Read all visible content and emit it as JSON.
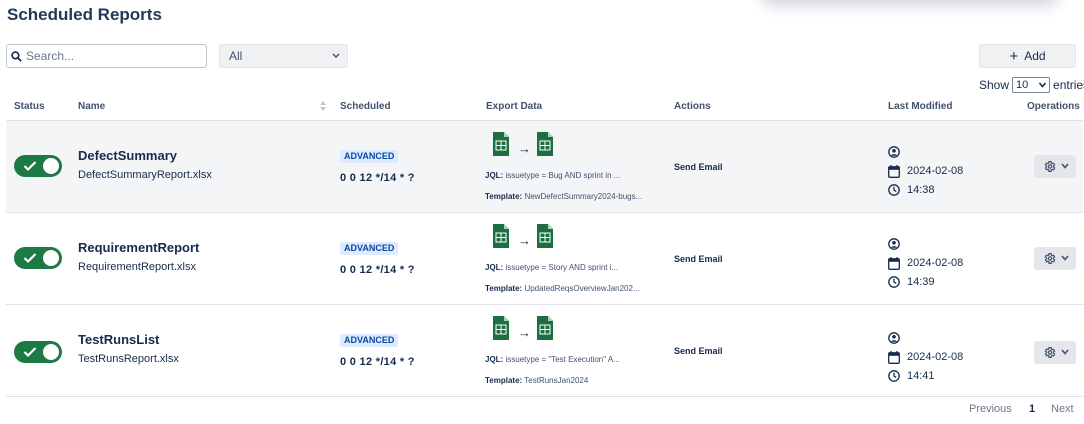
{
  "page": {
    "title": "Scheduled Reports"
  },
  "toolbar": {
    "search_placeholder": "Search...",
    "filter_value": "All",
    "add_label": "Add",
    "show_label": "Show",
    "entries_value": "10",
    "entries_label": "entries"
  },
  "columns": {
    "status": "Status",
    "name": "Name",
    "scheduled": "Scheduled",
    "export": "Export Data",
    "actions": "Actions",
    "modified": "Last Modified",
    "operations": "Operations"
  },
  "rows": [
    {
      "enabled": true,
      "name": "DefectSummary",
      "file": "DefectSummaryReport.xlsx",
      "badge": "ADVANCED",
      "cron": "0 0 12 */14 * ?",
      "jql_label": "JQL:",
      "jql": "issuetype = Bug AND sprint in ...",
      "template_label": "Template:",
      "template": "NewDefectSummary2024-bugs...",
      "action": "Send Email",
      "date": "2024-02-08",
      "time": "14:38"
    },
    {
      "enabled": true,
      "name": "RequirementReport",
      "file": "RequirementReport.xlsx",
      "badge": "ADVANCED",
      "cron": "0 0 12 */14 * ?",
      "jql_label": "JQL:",
      "jql": "issuetype = Story AND sprint i...",
      "template_label": "Template:",
      "template": "UpdatedReqsOverviewJan202...",
      "action": "Send Email",
      "date": "2024-02-08",
      "time": "14:39"
    },
    {
      "enabled": true,
      "name": "TestRunsList",
      "file": "TestRunsReport.xlsx",
      "badge": "ADVANCED",
      "cron": "0 0 12 */14 * ?",
      "jql_label": "JQL:",
      "jql": "issuetype = \"Test Execution\" A...",
      "template_label": "Template:",
      "template": "TestRunsJan2024",
      "action": "Send Email",
      "date": "2024-02-08",
      "time": "14:41"
    }
  ],
  "pagination": {
    "previous": "Previous",
    "current": "1",
    "next": "Next"
  },
  "colors": {
    "toggle_on": "#1e7a45",
    "badge_bg": "#deebff",
    "badge_text": "#0747a6",
    "excel_green": "#1d6f42"
  }
}
